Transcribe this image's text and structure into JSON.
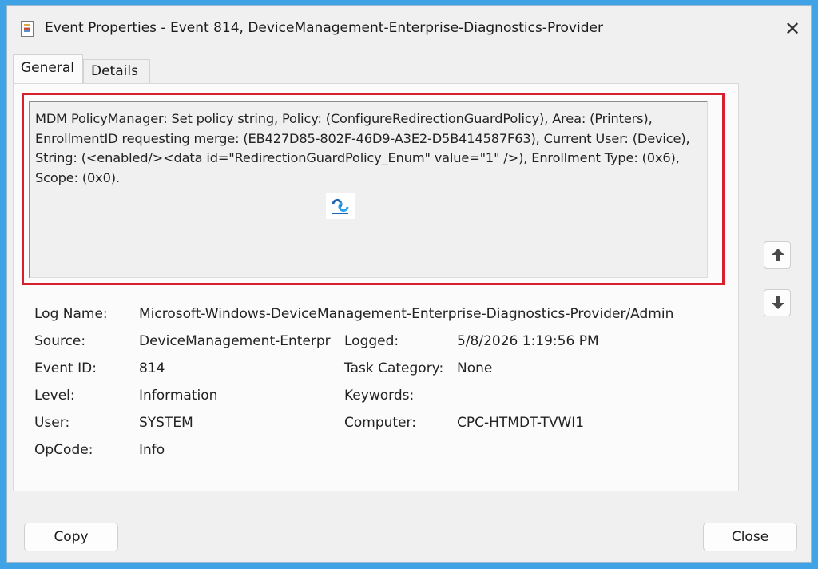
{
  "window": {
    "title": "Event Properties - Event 814, DeviceManagement-Enterprise-Diagnostics-Provider"
  },
  "tabs": [
    {
      "label": "General",
      "active": true
    },
    {
      "label": "Details",
      "active": false
    }
  ],
  "description": "MDM PolicyManager: Set policy string, Policy: (ConfigureRedirectionGuardPolicy), Area: (Printers), EnrollmentID requesting merge: (EB427D85-802F-46D9-A3E2-D5B414587F63), Current User: (Device), String: (<enabled/><data id=\"RedirectionGuardPolicy_Enum\" value=\"1\" />), Enrollment Type: (0x6), Scope: (0x0).",
  "details": {
    "log_name_label": "Log Name:",
    "log_name_value": "Microsoft-Windows-DeviceManagement-Enterprise-Diagnostics-Provider/Admin",
    "source_label": "Source:",
    "source_value": "DeviceManagement-Enterpr",
    "logged_label": "Logged:",
    "logged_value": "5/8/2026 1:19:56 PM",
    "event_id_label": "Event ID:",
    "event_id_value": "814",
    "task_category_label": "Task Category:",
    "task_category_value": "None",
    "level_label": "Level:",
    "level_value": "Information",
    "keywords_label": "Keywords:",
    "keywords_value": "",
    "user_label": "User:",
    "user_value": "SYSTEM",
    "computer_label": "Computer:",
    "computer_value": "CPC-HTMDT-TVWI1",
    "opcode_label": "OpCode:",
    "opcode_value": "Info"
  },
  "buttons": {
    "copy_label": "Copy",
    "close_label": "Close"
  },
  "icons": {
    "window": "event-viewer-icon",
    "close": "close-icon",
    "up": "arrow-up-icon",
    "down": "arrow-down-icon",
    "logo": "logo-icon"
  },
  "colors": {
    "background": "#3fa3e6",
    "highlight": "#d81f2e"
  }
}
